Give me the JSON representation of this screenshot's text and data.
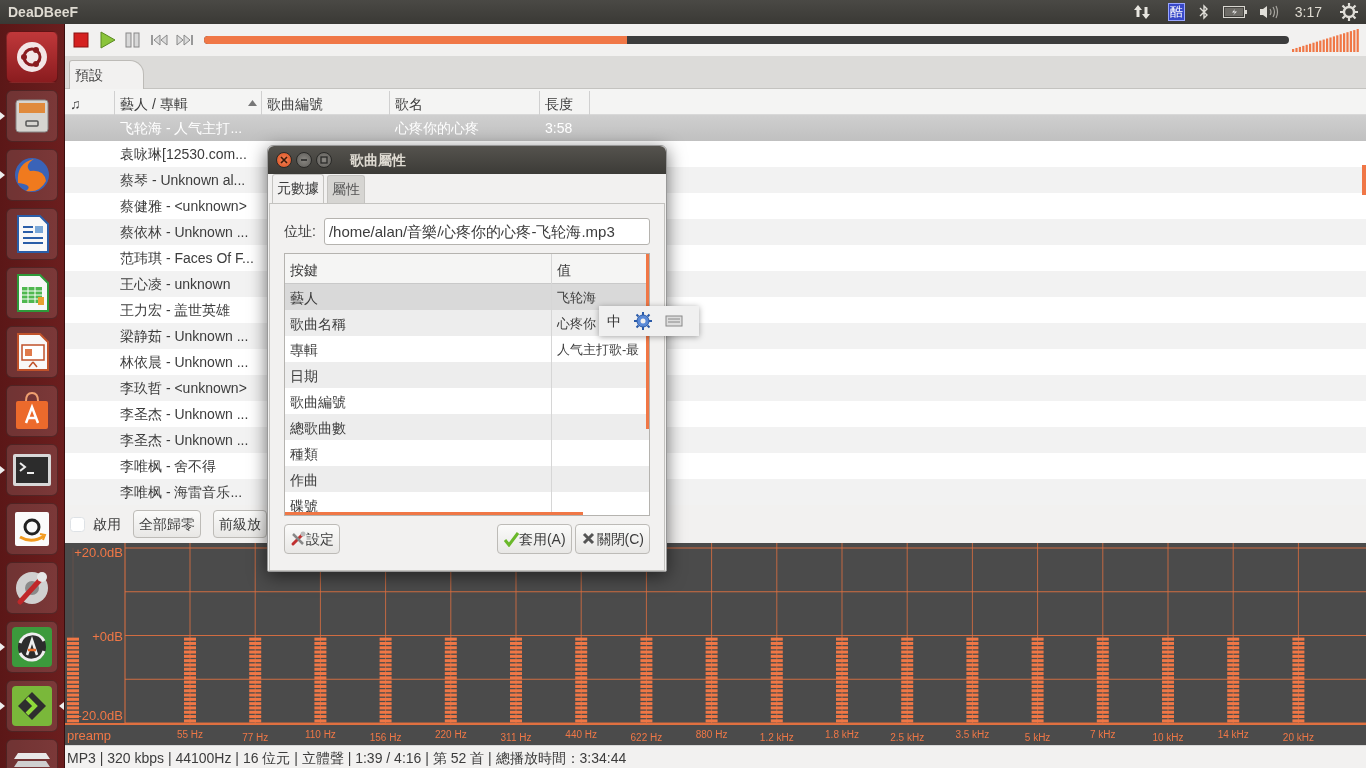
{
  "top_bar": {
    "app_title": "DeaDBeeF",
    "input_method": "酷",
    "clock": "3:17"
  },
  "launcher": {
    "items": [
      {
        "kind": "dash",
        "running": false,
        "focused": false
      },
      {
        "kind": "files",
        "running": true,
        "focused": false
      },
      {
        "kind": "browser",
        "running": true,
        "focused": false
      },
      {
        "kind": "writer",
        "running": false,
        "focused": false
      },
      {
        "kind": "calc",
        "running": false,
        "focused": false
      },
      {
        "kind": "impress",
        "running": false,
        "focused": false
      },
      {
        "kind": "store",
        "running": false,
        "focused": false
      },
      {
        "kind": "terminal",
        "running": true,
        "focused": false
      },
      {
        "kind": "amazon",
        "running": false,
        "focused": false
      },
      {
        "kind": "settings",
        "running": false,
        "focused": false
      },
      {
        "kind": "updater",
        "running": true,
        "focused": false
      },
      {
        "kind": "player",
        "running": true,
        "focused": true
      },
      {
        "kind": "workspaces",
        "running": false,
        "focused": false
      }
    ]
  },
  "toolbar": {
    "seek": {
      "level": 0.39
    },
    "volume": {
      "level": 1
    }
  },
  "playlist_tabs": [
    {
      "label": "預設",
      "selected": true
    }
  ],
  "playlist": {
    "columns": [
      {
        "label": "♫",
        "sorted": false
      },
      {
        "label": "藝人 / 專輯",
        "sorted": true
      },
      {
        "label": "歌曲編號",
        "sorted": false
      },
      {
        "label": "歌名",
        "sorted": false
      },
      {
        "label": "長度",
        "sorted": false
      }
    ],
    "rows": [
      {
        "artist_album": "飞轮海 - 人气主打...",
        "title": "心疼你的心疼",
        "length": "3:58",
        "selected": true
      },
      {
        "artist_album": "袁咏琳[12530.com...",
        "selected": false
      },
      {
        "artist_album": "蔡琴 - Unknown al...",
        "selected": false
      },
      {
        "artist_album": "蔡健雅 - <unknown>",
        "selected": false
      },
      {
        "artist_album": "蔡依林 - Unknown ...",
        "selected": false
      },
      {
        "artist_album": "范玮琪 - Faces Of F...",
        "selected": false
      },
      {
        "artist_album": "王心凌 - unknown",
        "selected": false
      },
      {
        "artist_album": "王力宏 - 盖世英雄",
        "selected": false
      },
      {
        "artist_album": "梁静茹 - Unknown ...",
        "selected": false
      },
      {
        "artist_album": "林依晨 - Unknown ...",
        "selected": false
      },
      {
        "artist_album": "李玖哲 - <unknown>",
        "selected": false
      },
      {
        "artist_album": "李圣杰 - Unknown ...",
        "selected": false
      },
      {
        "artist_album": "李圣杰 - Unknown ...",
        "selected": false
      },
      {
        "artist_album": "李唯枫 - 舍不得",
        "selected": false
      },
      {
        "artist_album": "李唯枫 - 海雷音乐...",
        "selected": false
      }
    ]
  },
  "equalizer": {
    "enable_label": "啟用",
    "enabled": false,
    "buttons": [
      "全部歸零",
      "前級放"
    ],
    "scale": [
      "+20.0dB",
      "+0dB",
      "-20.0dB"
    ],
    "preamp": {
      "label": "preamp",
      "level": 0.5
    },
    "bands": [
      {
        "label": "55 Hz",
        "level": 0.5
      },
      {
        "label": "77 Hz",
        "level": 0.5
      },
      {
        "label": "110 Hz",
        "level": 0.5
      },
      {
        "label": "156 Hz",
        "level": 0.5
      },
      {
        "label": "220 Hz",
        "level": 0.5
      },
      {
        "label": "311 Hz",
        "level": 0.5
      },
      {
        "label": "440 Hz",
        "level": 0.5
      },
      {
        "label": "622 Hz",
        "level": 0.5
      },
      {
        "label": "880 Hz",
        "level": 0.5
      },
      {
        "label": "1.2 kHz",
        "level": 0.5
      },
      {
        "label": "1.8 kHz",
        "level": 0.5
      },
      {
        "label": "2.5 kHz",
        "level": 0.5
      },
      {
        "label": "3.5 kHz",
        "level": 0.5
      },
      {
        "label": "5 kHz",
        "level": 0.5
      },
      {
        "label": "7 kHz",
        "level": 0.5
      },
      {
        "label": "10 kHz",
        "level": 0.5
      },
      {
        "label": "14 kHz",
        "level": 0.5
      },
      {
        "label": "20 kHz",
        "level": 0.5
      }
    ]
  },
  "status_bar": "MP3 | 320 kbps | 44100Hz | 16 位元 | 立體聲 | 1:39 / 4:16 | 第 52 首 | 總播放時間：3:34:44",
  "dialog": {
    "title": "歌曲屬性",
    "tabs": [
      {
        "label": "元數據",
        "selected": true
      },
      {
        "label": "屬性",
        "selected": false
      }
    ],
    "location_label": "位址:",
    "location": "/home/alan/音樂/心疼你的心疼-飞轮海.mp3",
    "columns": [
      "按鍵",
      "值"
    ],
    "fields": [
      {
        "key": "藝人",
        "value": "飞轮海",
        "selected": true
      },
      {
        "key": "歌曲名稱",
        "value": "心疼你",
        "selected": false
      },
      {
        "key": "專輯",
        "value": "人气主打歌-最",
        "selected": false
      },
      {
        "key": "日期",
        "selected": false
      },
      {
        "key": "歌曲編號",
        "selected": false
      },
      {
        "key": "總歌曲數",
        "selected": false
      },
      {
        "key": "種類",
        "selected": false
      },
      {
        "key": "作曲",
        "selected": false
      },
      {
        "key": "碟號",
        "selected": false
      }
    ],
    "buttons": [
      {
        "kind": "settings",
        "label": "設定"
      },
      {
        "kind": "apply",
        "label": "套用(A)"
      },
      {
        "kind": "close",
        "label": "關閉(C)"
      }
    ]
  },
  "ime_popup": {
    "mode": "中"
  }
}
